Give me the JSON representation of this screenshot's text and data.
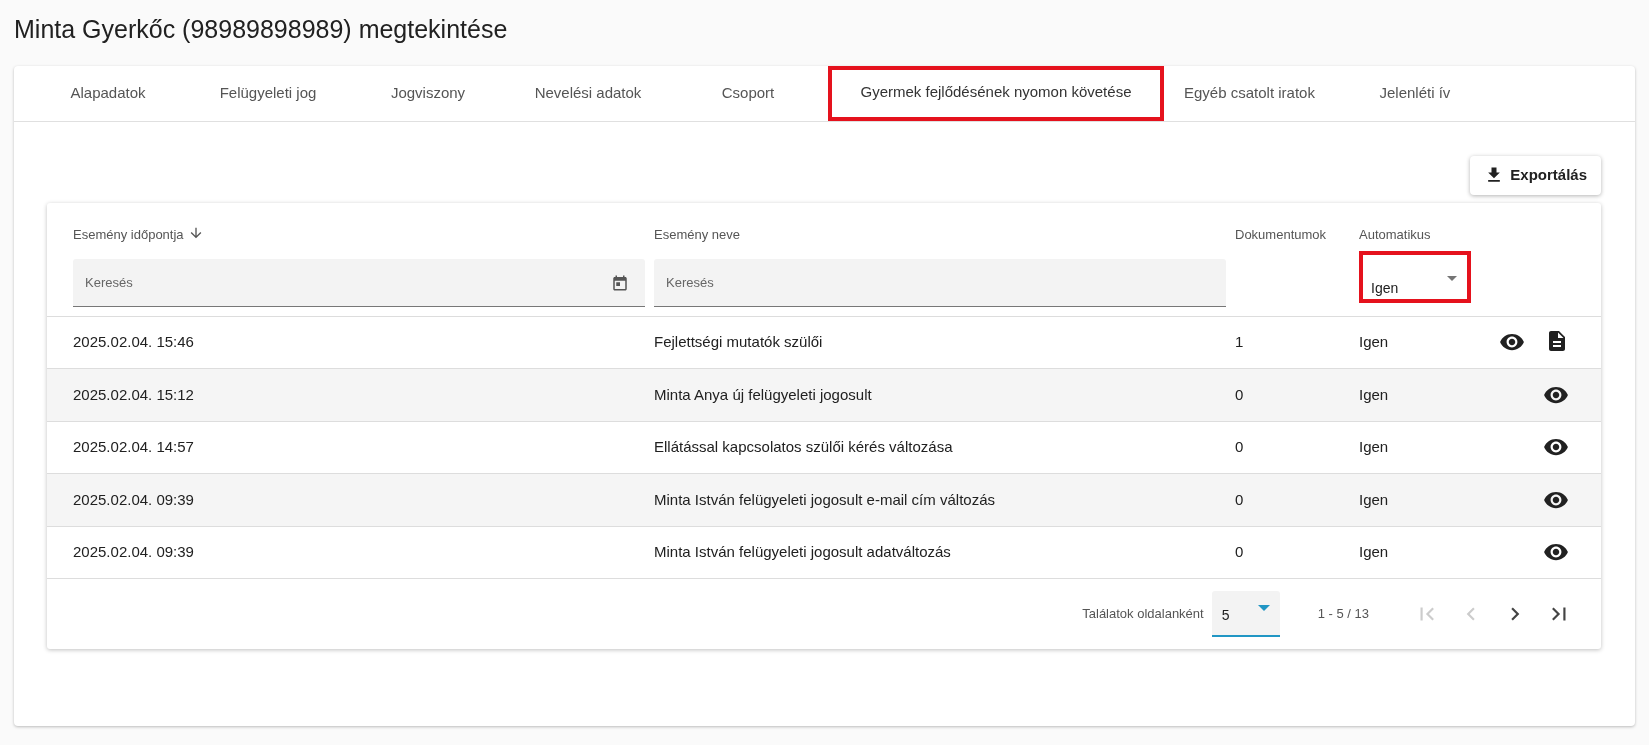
{
  "page_title": "Minta Gyerkőc (98989898989) megtekintése",
  "tabs": [
    {
      "label": "Alapadatok",
      "selected": false,
      "highlighted": false
    },
    {
      "label": "Felügyeleti jog",
      "selected": false,
      "highlighted": false
    },
    {
      "label": "Jogviszony",
      "selected": false,
      "highlighted": false
    },
    {
      "label": "Nevelési adatok",
      "selected": false,
      "highlighted": false
    },
    {
      "label": "Csoport",
      "selected": false,
      "highlighted": false
    },
    {
      "label": "Gyermek fejlődésének nyomon követése",
      "selected": true,
      "highlighted": true
    },
    {
      "label": "Egyéb csatolt iratok",
      "selected": false,
      "highlighted": false
    },
    {
      "label": "Jelenléti ív",
      "selected": false,
      "highlighted": false
    }
  ],
  "export_button": "Exportálás",
  "table": {
    "columns": [
      {
        "label": "Esemény időpontja",
        "sorted": true
      },
      {
        "label": "Esemény neve",
        "sorted": false
      },
      {
        "label": "Dokumentumok",
        "sorted": false
      },
      {
        "label": "Automatikus",
        "sorted": false
      }
    ],
    "filters": [
      {
        "kind": "date",
        "placeholder": "Keresés"
      },
      {
        "kind": "text",
        "placeholder": "Keresés"
      },
      {
        "kind": "none"
      },
      {
        "kind": "select",
        "value": "Igen",
        "highlighted": true
      }
    ],
    "rows": [
      {
        "cells": [
          "2025.02.04. 15:46",
          "Fejlettségi mutatók szülői",
          "1",
          "Igen"
        ],
        "has_document": true
      },
      {
        "cells": [
          "2025.02.04. 15:12",
          "Minta Anya új felügyeleti jogosult",
          "0",
          "Igen"
        ],
        "has_document": false
      },
      {
        "cells": [
          "2025.02.04. 14:57",
          "Ellátással kapcsolatos szülői kérés változása",
          "0",
          "Igen"
        ],
        "has_document": false
      },
      {
        "cells": [
          "2025.02.04. 09:39",
          "Minta István felügyeleti jogosult e-mail cím változás",
          "0",
          "Igen"
        ],
        "has_document": false
      },
      {
        "cells": [
          "2025.02.04. 09:39",
          "Minta István felügyeleti jogosult adatváltozás",
          "0",
          "Igen"
        ],
        "has_document": false
      }
    ]
  },
  "pagination": {
    "per_page_label": "Találatok oldalanként",
    "per_page": "5",
    "range": "1 - 5 / 13",
    "buttons": [
      {
        "kind": "first",
        "disabled": true
      },
      {
        "kind": "prev",
        "disabled": true
      },
      {
        "kind": "next",
        "disabled": false
      },
      {
        "kind": "last",
        "disabled": false
      }
    ]
  }
}
